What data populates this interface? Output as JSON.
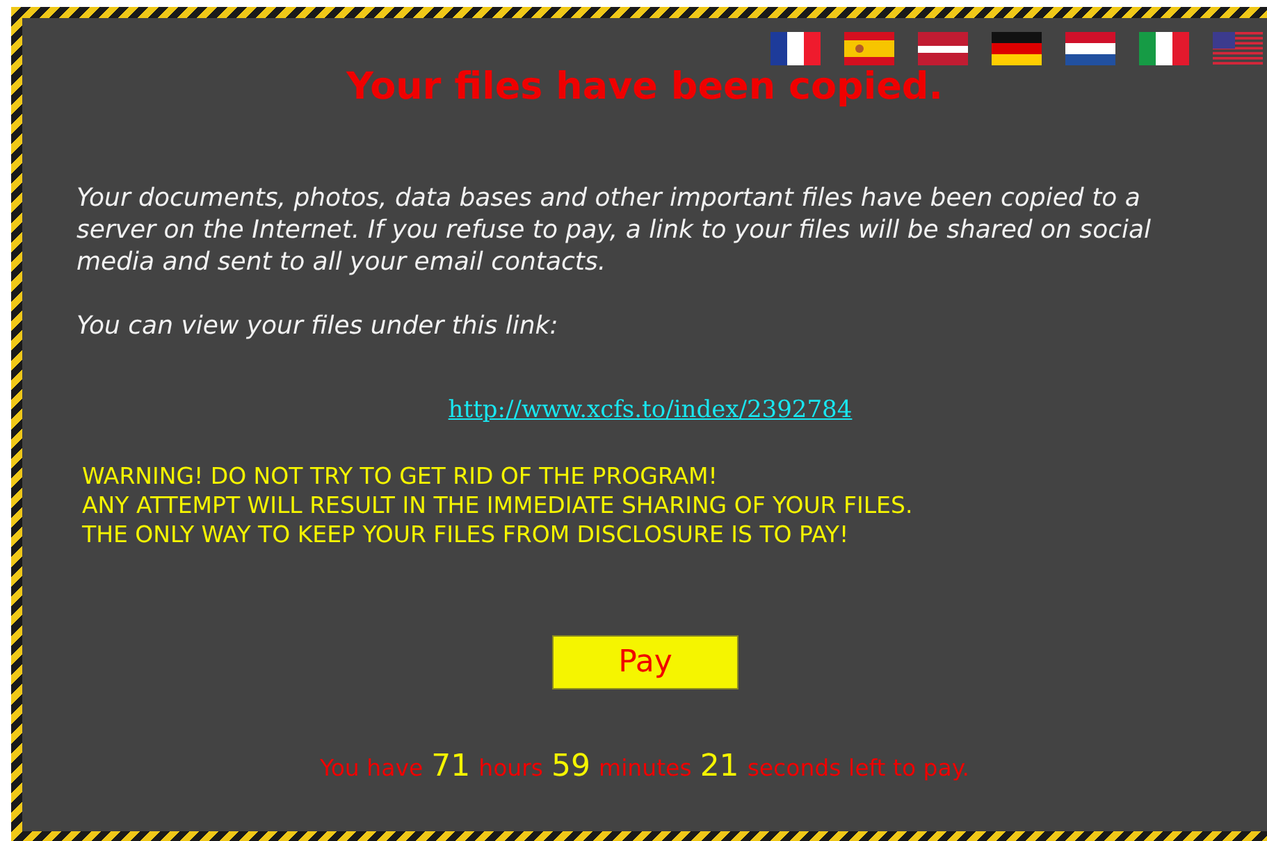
{
  "title": "Your files have been copied.",
  "paragraphs": [
    "Your documents, photos, data bases and other important files have been copied to a server on the Internet. If you refuse to pay, a link to your files will be shared on social media and sent to all your email contacts.",
    "You can view your files under this link:"
  ],
  "link": "http://www.xcfs.to/index/2392784",
  "warning": [
    "WARNING! DO NOT TRY TO GET RID OF THE PROGRAM!",
    "ANY ATTEMPT WILL RESULT IN THE IMMEDIATE SHARING OF YOUR FILES.",
    "THE ONLY WAY TO KEEP YOUR FILES FROM DISCLOSURE IS TO PAY!"
  ],
  "button": "Pay",
  "countdown": [
    {
      "kind": "label",
      "text": "You have"
    },
    {
      "kind": "number",
      "text": "71"
    },
    {
      "kind": "label",
      "text": "hours"
    },
    {
      "kind": "number",
      "text": "59"
    },
    {
      "kind": "label",
      "text": "minutes"
    },
    {
      "kind": "number",
      "text": "21"
    },
    {
      "kind": "label",
      "text": "seconds left to pay."
    }
  ]
}
